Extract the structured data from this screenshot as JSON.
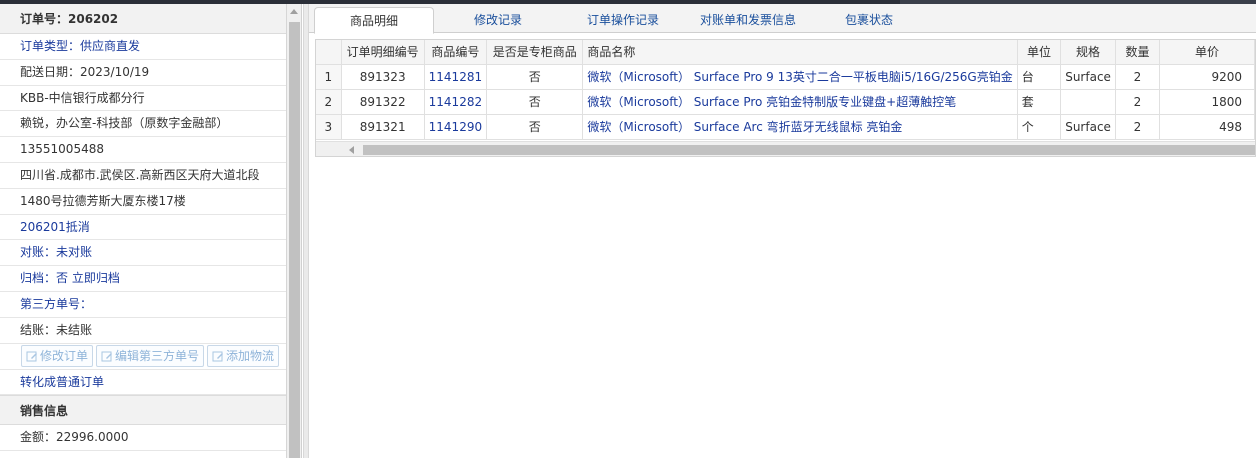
{
  "order": {
    "header": "订单号：206202",
    "rows": [
      {
        "text": "订单类型：供应商直发",
        "style": "blue"
      },
      {
        "text": "配送日期：2023/10/19",
        "style": "dark"
      },
      {
        "text": "KBB-中信银行成都分行",
        "style": "dark"
      },
      {
        "text": "赖锐，办公室-科技部（原数字金融部）",
        "style": "dark"
      },
      {
        "text": "13551005488",
        "style": "dark"
      },
      {
        "text": "四川省.成都市.武侯区.高新西区天府大道北段",
        "style": "dark"
      },
      {
        "text": "1480号拉德芳斯大厦东楼17楼",
        "style": "dark"
      },
      {
        "text": "206201抵消",
        "style": "blue"
      },
      {
        "text": "对账：未对账",
        "style": "blue"
      },
      {
        "text": "归档：否 立即归档",
        "style": "blue"
      },
      {
        "text": "第三方单号：",
        "style": "blue"
      },
      {
        "text": "结账：未结账",
        "style": "dark"
      }
    ],
    "buttons": [
      "修改订单",
      "编辑第三方单号",
      "添加物流"
    ],
    "convert": "转化成普通订单",
    "sales_section": "销售信息",
    "amount": "金额：22996.0000"
  },
  "tabs": [
    "商品明细",
    "修改记录",
    "订单操作记录",
    "对账单和发票信息",
    "包裹状态"
  ],
  "table": {
    "headers": [
      "",
      "订单明细编号",
      "商品编号",
      "是否是专柜商品",
      "商品名称",
      "单位",
      "规格",
      "数量",
      "单价"
    ],
    "rows": [
      [
        "1",
        "891323",
        "1141281",
        "否",
        "微软（Microsoft） Surface Pro 9 13英寸二合一平板电脑i5/16G/256G亮铂金",
        "台",
        "Surface",
        "2",
        "9200"
      ],
      [
        "2",
        "891322",
        "1141282",
        "否",
        "微软（Microsoft） Surface Pro 亮铂金特制版专业键盘+超薄触控笔",
        "套",
        "",
        "2",
        "1800"
      ],
      [
        "3",
        "891321",
        "1141290",
        "否",
        "微软（Microsoft） Surface Arc 弯折蓝牙无线鼠标 亮铂金",
        "个",
        "Surface",
        "2",
        "498"
      ]
    ]
  },
  "colors": {
    "link": "#1a3a9c",
    "tab_text": "#1a4f9c",
    "disabled_btn": "#8fb4d9"
  }
}
